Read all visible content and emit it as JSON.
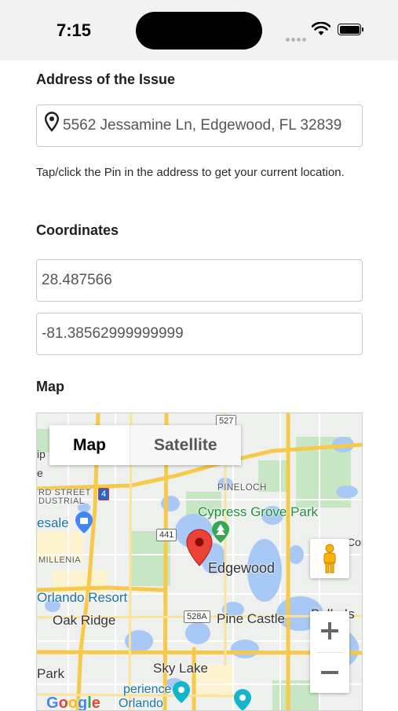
{
  "status_bar": {
    "time": "7:15"
  },
  "form": {
    "address_label": "Address of the Issue",
    "address_value": "5562 Jessamine Ln, Edgewood, FL 32839",
    "help_text": "Tap/click the Pin in the address to get your current location.",
    "coordinates_label": "Coordinates",
    "latitude": "28.487566",
    "longitude": "-81.38562999999999",
    "map_label": "Map"
  },
  "map": {
    "type_buttons": {
      "map": "Map",
      "satellite": "Satellite"
    },
    "selected_type": "Map",
    "zoom_in": "+",
    "zoom_out": "−",
    "places": {
      "edgewood": "Edgewood",
      "cypress_grove_park": "Cypress Grove Park",
      "pineloch": "PINELOCH",
      "oak_ridge": "Oak Ridge",
      "pine_castle": "Pine Castle",
      "belle_isle": "Belle Is",
      "sky_lake": "Sky Lake",
      "orlando_resort": "Orlando Resort",
      "millenia": "MILLENIA",
      "ard_street": "RD STREET",
      "industrial": "DUSTRIAL",
      "esale": "esale",
      "park": "Park",
      "experience": "perience",
      "orlando": "Orlando",
      "cor": "Cor",
      "re": "e",
      "ip": "ip"
    },
    "shields": {
      "r527": "527",
      "r441": "441",
      "r528a": "528A",
      "i4": "4"
    },
    "marker_color": "#ea4335",
    "park_color": "#34a853",
    "water_color": "#a8c8f5",
    "road_color": "#f6c94a"
  }
}
